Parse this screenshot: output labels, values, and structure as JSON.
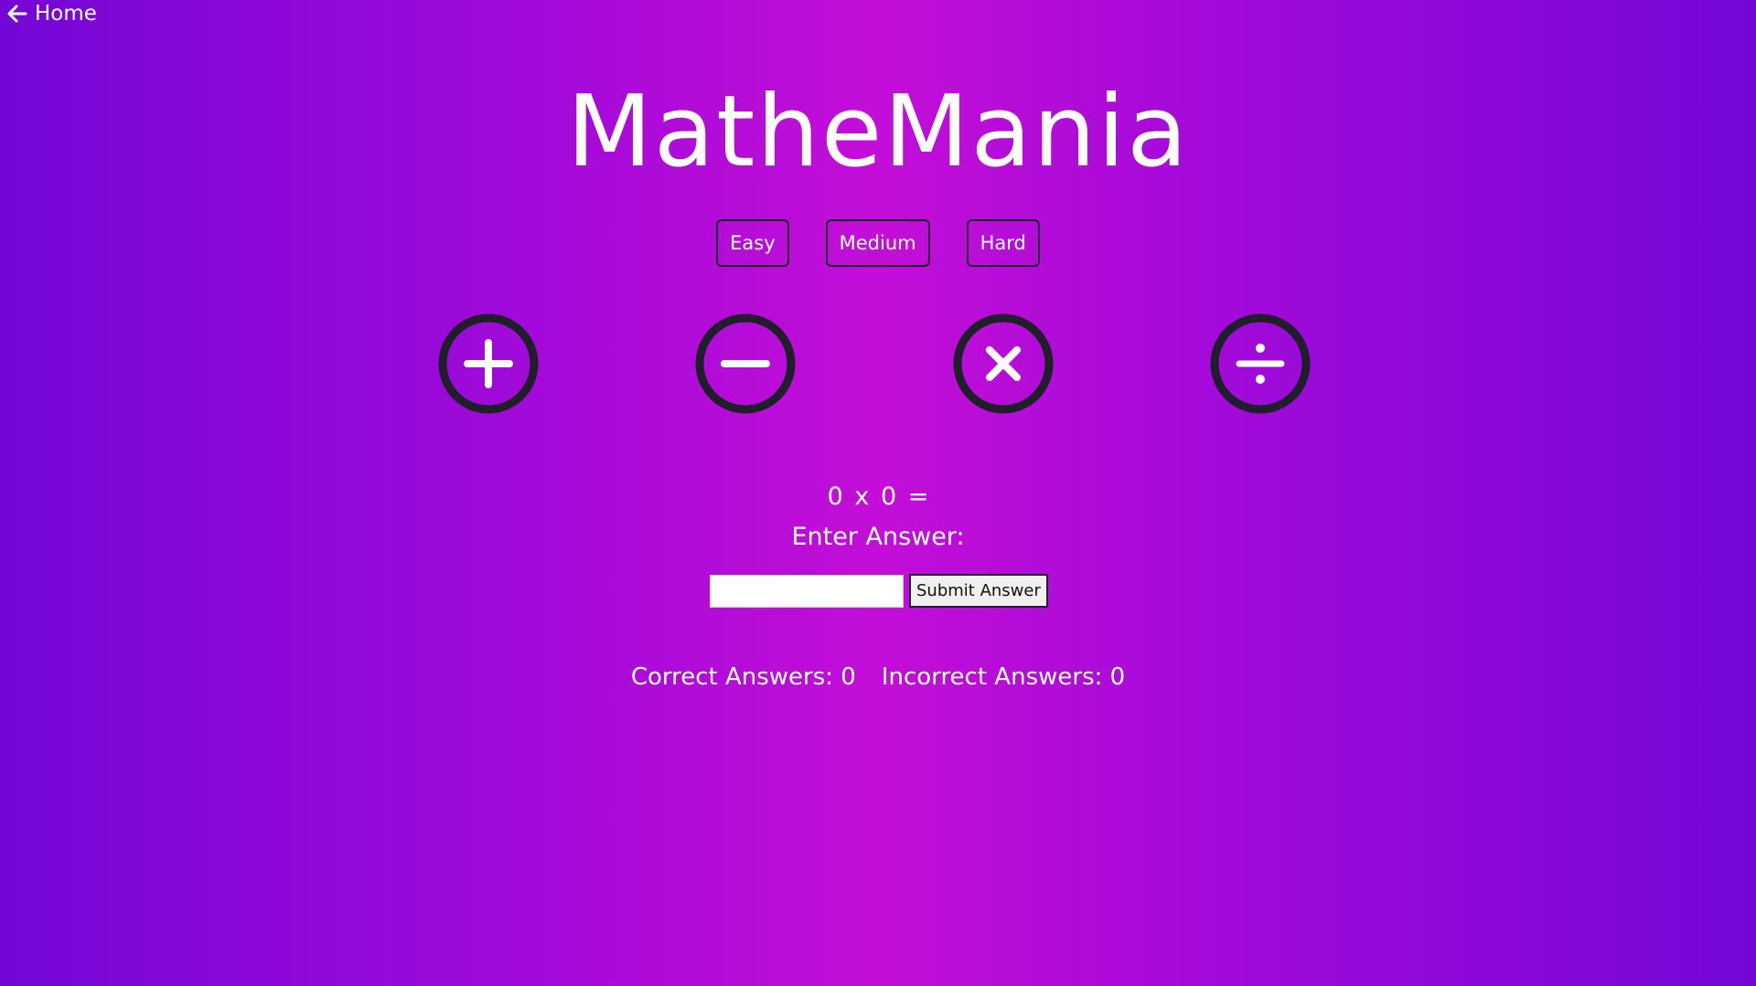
{
  "nav": {
    "home_label": "Home"
  },
  "app": {
    "title": "MatheMania"
  },
  "difficulty": {
    "easy": "Easy",
    "medium": "Medium",
    "hard": "Hard"
  },
  "operations": [
    "plus-icon",
    "minus-icon",
    "multiply-icon",
    "divide-icon"
  ],
  "question": {
    "left": "0",
    "operator": "x",
    "right": "0",
    "equals": "="
  },
  "answer": {
    "prompt": "Enter Answer:",
    "input_value": "",
    "input_placeholder": "",
    "submit_label": "Submit Answer"
  },
  "score": {
    "correct": "Correct Answers: 0",
    "incorrect": "Incorrect Answers: 0"
  },
  "colors": {
    "icon": "#1f1f2a",
    "gradient_edge": "#7407d6",
    "gradient_center": "#c30ed8"
  }
}
